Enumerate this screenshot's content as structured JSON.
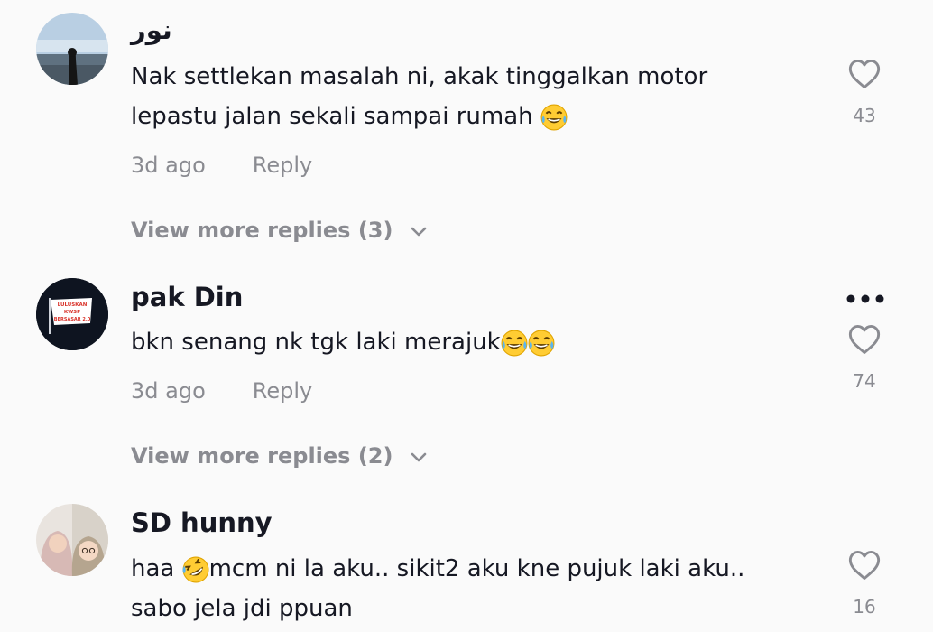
{
  "comments": [
    {
      "username": "نور",
      "text_line1": "Nak settlekan masalah ni, akak tinggalkan motor",
      "text_line2": "lepastu jalan sekali sampai rumah",
      "time": "3d ago",
      "reply_label": "Reply",
      "likes": "43",
      "view_more": "View more replies (3)"
    },
    {
      "username": "pak Din",
      "text": "bkn senang nk tgk laki merajuk",
      "time": "3d ago",
      "reply_label": "Reply",
      "likes": "74",
      "view_more": "View more replies (2)",
      "avatar_text": "LULUSKAN KWSP BERSASAR 2.0"
    },
    {
      "username": "SD hunny",
      "text_before_emoji": "haa ",
      "text_after_emoji": "mcm ni la aku.. sikit2 aku kne pujuk laki aku..",
      "text_line2": "sabo jela jdi ppuan",
      "likes": "16"
    }
  ],
  "icons": {
    "like": "heart-icon",
    "more": "more-options-icon",
    "expand": "chevron-down-icon",
    "emoji_laugh": "tears-of-joy-emoji",
    "emoji_rofl": "rolling-laughing-emoji"
  },
  "colors": {
    "text": "#161823",
    "muted": "#8a8b91",
    "background": "#fafafa"
  }
}
